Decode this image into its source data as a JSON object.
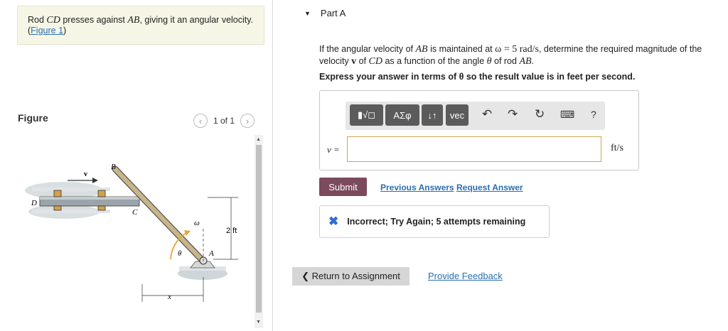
{
  "problem": {
    "text_pre": "Rod ",
    "cd": "CD",
    "text_mid": " presses against ",
    "ab": "AB",
    "text_post": ", giving it an angular velocity. (",
    "fig_link": "Figure 1",
    "close": ")"
  },
  "figure": {
    "label": "Figure",
    "pager": "1 of 1",
    "labels": {
      "B": "B",
      "D": "D",
      "C": "C",
      "A": "A",
      "v": "v",
      "omega": "ω",
      "theta": "θ",
      "x": "x",
      "dim": "2 ft"
    }
  },
  "part": {
    "title": "Part A",
    "q1": "If the angular velocity of ",
    "q_ab": "AB",
    "q2": " is maintained at ",
    "q_omega": "ω = 5 rad/s",
    "q3": ", determine the required magnitude of the velocity ",
    "q_v": "v",
    "q4": " of ",
    "q_cd": "CD",
    "q5": " as a function of the angle ",
    "q_theta": "θ",
    "q6": " of rod ",
    "q_ab2": "AB",
    "q7": ".",
    "instruction": "Express your answer in terms of θ so the result value is in feet per second."
  },
  "toolbar": {
    "templates": "▮√◻",
    "greek": "ΑΣφ",
    "arrows": "↓↑",
    "vec": "vec",
    "help": "?"
  },
  "answer": {
    "label": "v =",
    "value": "",
    "unit": "ft/s"
  },
  "actions": {
    "submit": "Submit",
    "previous": "Previous Answers",
    "request": "Request Answer"
  },
  "feedback": {
    "text": "Incorrect; Try Again; 5 attempts remaining"
  },
  "footer": {
    "return": "❮ Return to Assignment",
    "feedback": "Provide Feedback"
  }
}
